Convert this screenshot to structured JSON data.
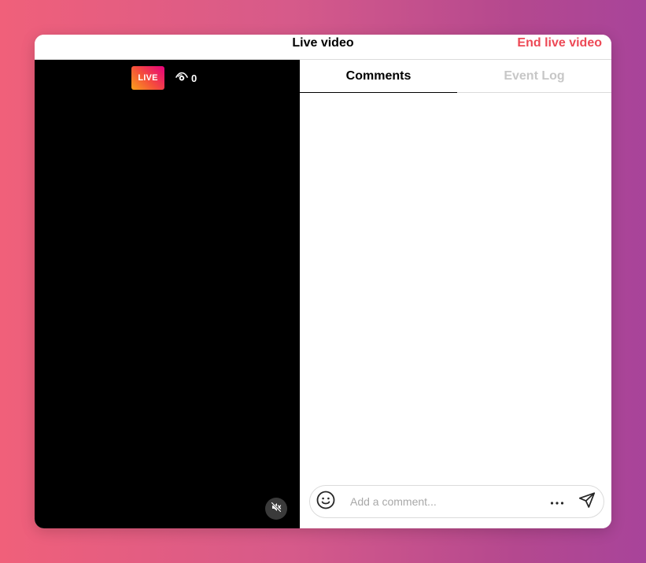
{
  "window": {
    "title": "Live video",
    "end_button_label": "End live video"
  },
  "video": {
    "live_badge": "LIVE",
    "viewer_count": "0",
    "icons": {
      "viewers": "eye-icon",
      "mute": "muted-speaker-icon"
    }
  },
  "panel": {
    "tabs": [
      {
        "label": "Comments",
        "active": true
      },
      {
        "label": "Event Log",
        "active": false
      }
    ],
    "comment_box": {
      "placeholder": "Add a comment...",
      "value": "",
      "icons": {
        "emoji": "smiley-icon",
        "more": "more-horizontal-icon",
        "send": "send-paper-plane-icon"
      }
    }
  },
  "colors": {
    "accent_red": "#ed4956",
    "video_background": "#000000",
    "inactive_tab": "#c7c7c7"
  }
}
